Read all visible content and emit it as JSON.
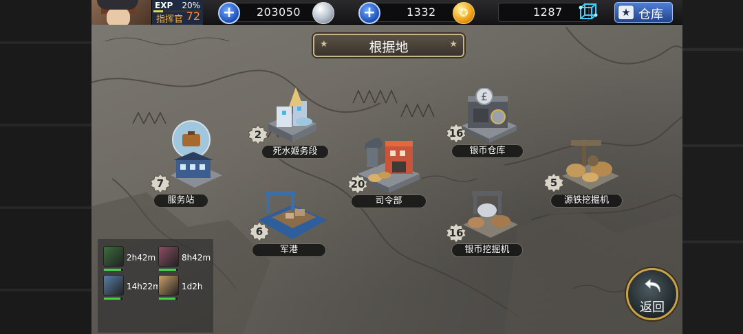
{
  "player": {
    "exp_label": "EXP",
    "exp_percent": "20%",
    "exp_fraction": 0.2,
    "rank": "指挥官",
    "level": "72"
  },
  "resources": {
    "silver": "203050",
    "gold": "1332",
    "cube": "1287",
    "gold_symbol": "✪",
    "plus_symbol": "+"
  },
  "warehouse": {
    "label": "仓库",
    "icon": "★"
  },
  "banner": {
    "title": "根据地",
    "star_left": "★",
    "star_right": "★"
  },
  "buildings": [
    {
      "name": "死水姬务段",
      "level": "2",
      "icon": "tower-icon"
    },
    {
      "name": "服务站",
      "level": "7",
      "icon": "service-station-icon"
    },
    {
      "name": "司令部",
      "level": "20",
      "icon": "headquarters-icon"
    },
    {
      "name": "银币仓库",
      "level": "16",
      "icon": "silver-vault-icon"
    },
    {
      "name": "源铁挖掘机",
      "level": "5",
      "icon": "iron-excavator-icon"
    },
    {
      "name": "军港",
      "level": "6",
      "icon": "naval-port-icon"
    },
    {
      "name": "银币挖掘机",
      "level": "16",
      "icon": "silver-excavator-icon"
    }
  ],
  "squads": [
    {
      "time": "2h42m",
      "hp": 0.9,
      "color": "#3a6e3c"
    },
    {
      "time": "8h42m",
      "hp": 0.9,
      "color": "#8a4e62"
    },
    {
      "time": "14h22m",
      "hp": 0.85,
      "color": "#5a7fa8"
    },
    {
      "time": "1d2h",
      "hp": 0.85,
      "color": "#c9a06b"
    }
  ],
  "back_button": {
    "label": "返回"
  },
  "colors": {
    "accent_blue": "#1c4fb6",
    "gold": "#c9a34c",
    "hp_green": "#43d24a",
    "rank_orange": "#ffb13b"
  }
}
